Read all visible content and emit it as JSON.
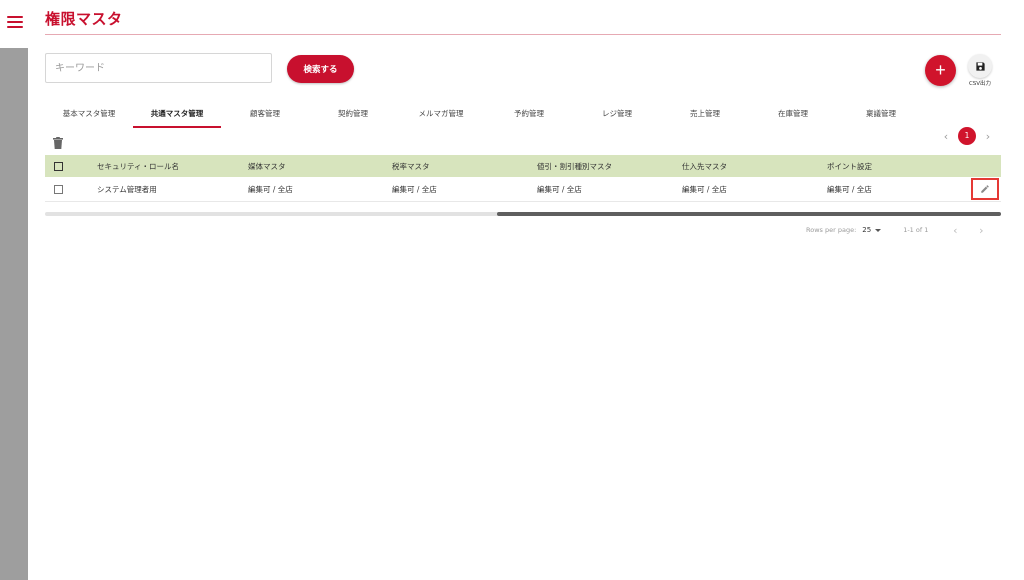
{
  "header": {
    "title": "権限マスタ"
  },
  "search": {
    "placeholder": "キーワード",
    "button_label": "検索する"
  },
  "actions": {
    "add_label": "+",
    "csv_label": "CSV出力"
  },
  "tabs": [
    {
      "label": "基本マスタ管理"
    },
    {
      "label": "共通マスタ管理"
    },
    {
      "label": "顧客管理"
    },
    {
      "label": "契約管理"
    },
    {
      "label": "メルマガ管理"
    },
    {
      "label": "予約管理"
    },
    {
      "label": "レジ管理"
    },
    {
      "label": "売上管理"
    },
    {
      "label": "在庫管理"
    },
    {
      "label": "稟議管理"
    }
  ],
  "active_tab": "共通マスタ管理",
  "pager_top": {
    "prev": "‹",
    "current": "1",
    "next": "›"
  },
  "table": {
    "columns": [
      "セキュリティ・ロール名",
      "媒体マスタ",
      "税率マスタ",
      "値引・割引種別マスタ",
      "仕入先マスタ",
      "ポイント設定"
    ],
    "rows": [
      [
        "システム管理者用",
        "編集可 / 全店",
        "編集可 / 全店",
        "編集可 / 全店",
        "編集可 / 全店",
        "編集可 / 全店"
      ]
    ]
  },
  "footer": {
    "rows_per_page_label": "Rows per page:",
    "rows_per_page_value": "25",
    "range": "1-1 of 1",
    "prev": "‹",
    "next": "›"
  },
  "colors": {
    "accent": "#c8102e",
    "header_bg": "#d7e4bd",
    "rail": "#9e9e9e"
  }
}
